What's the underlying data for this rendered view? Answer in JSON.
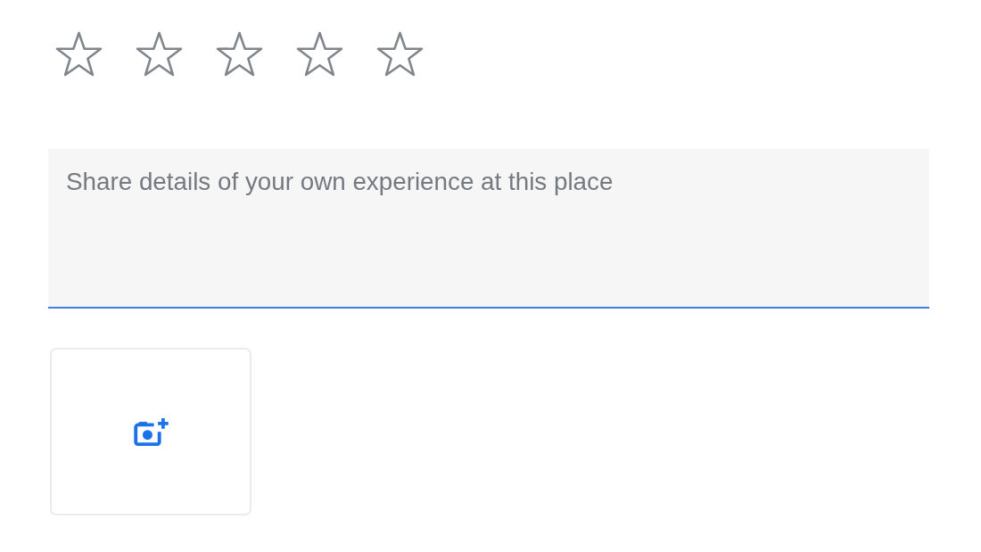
{
  "rating": {
    "stars": 0
  },
  "review": {
    "placeholder": "Share details of your own experience at this place"
  }
}
